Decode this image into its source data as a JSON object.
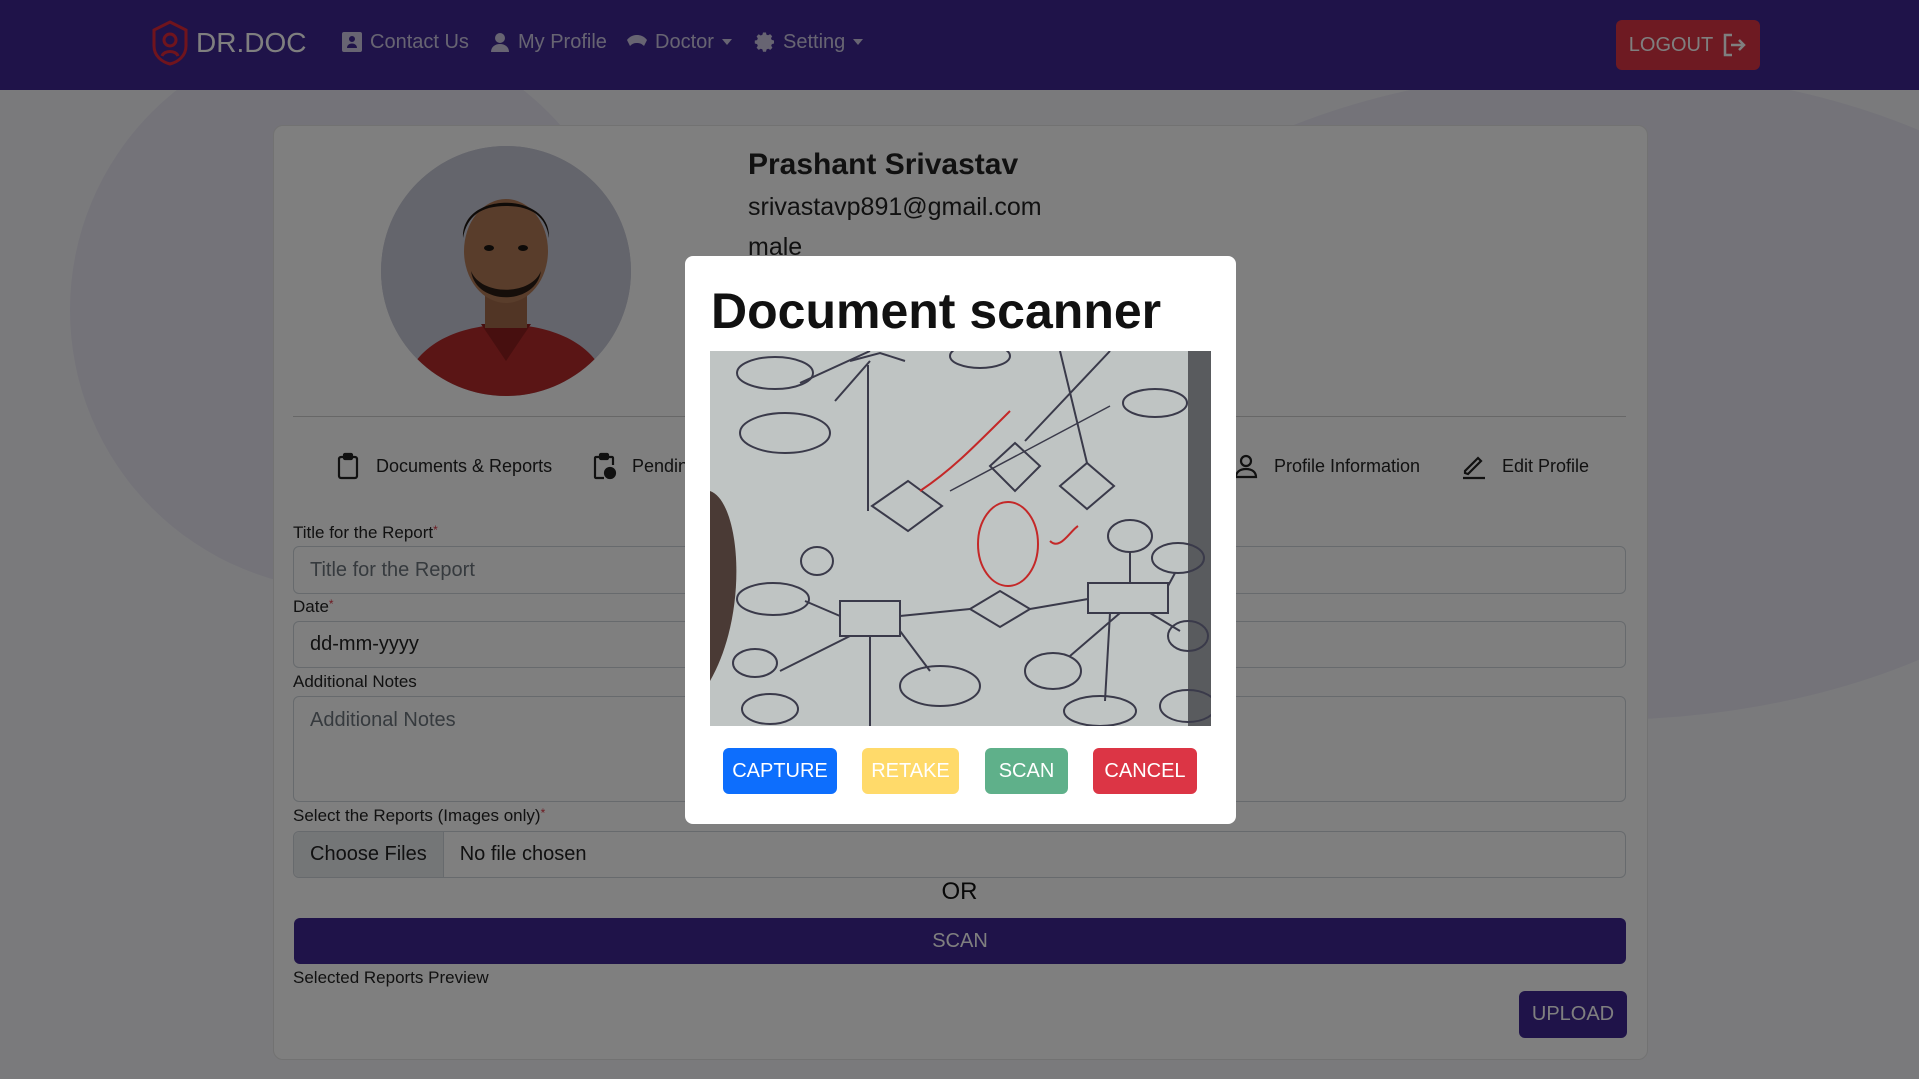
{
  "navbar": {
    "brand": "DR.DOC",
    "items": [
      {
        "label": "Contact Us",
        "icon": "contact-card-icon"
      },
      {
        "label": "My Profile",
        "icon": "user-icon"
      },
      {
        "label": "Doctor",
        "icon": "doctor-icon"
      },
      {
        "label": "Setting",
        "icon": "gear-icon"
      }
    ],
    "logout_label": "LOGOUT"
  },
  "profile": {
    "name": "Prashant Srivastav",
    "email": "srivastavp891@gmail.com",
    "gender": "male"
  },
  "tabs": [
    {
      "label": "Documents & Reports",
      "icon": "clipboard-icon"
    },
    {
      "label": "Pendin",
      "icon": "clipboard-clock-icon"
    },
    {
      "label": "Profile Information",
      "icon": "user-outline-icon"
    },
    {
      "label": "Edit Profile",
      "icon": "pencil-icon"
    }
  ],
  "form": {
    "title_label": "Title for the Report",
    "title_placeholder": "Title for the Report",
    "date_label": "Date",
    "date_placeholder": "dd-mm-yyyy",
    "notes_label": "Additional Notes",
    "notes_placeholder": "Additional Notes",
    "reports_label": "Select the Reports (Images only)",
    "choose_files_label": "Choose Files",
    "file_status": "No file chosen",
    "required_mark": "*",
    "or_text": "OR",
    "scan_label": "SCAN",
    "preview_label": "Selected Reports Preview",
    "upload_label": "UPLOAD"
  },
  "modal": {
    "title": "Document scanner",
    "capture_label": "CAPTURE",
    "retake_label": "RETAKE",
    "scan_label": "SCAN",
    "cancel_label": "CANCEL"
  },
  "colors": {
    "brand": "#3e2793",
    "danger": "#dc3545",
    "primary": "#0d6efd",
    "warning": "#ffda6a",
    "success": "#5fb08a"
  }
}
